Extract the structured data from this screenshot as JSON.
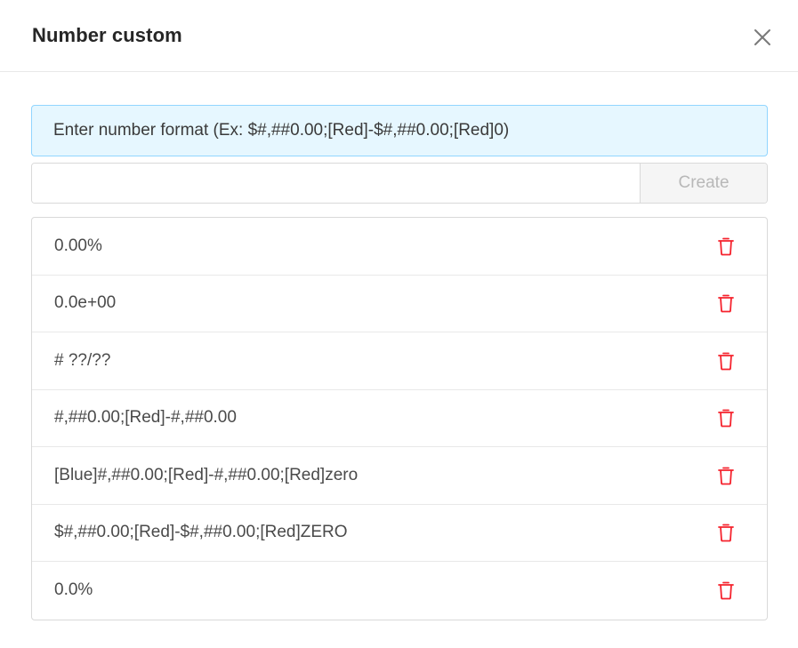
{
  "dialog": {
    "title": "Number custom",
    "close_icon": "close-icon"
  },
  "hint": {
    "text": "Enter number format (Ex: $#,##0.00;[Red]-$#,##0.00;[Red]0)"
  },
  "form": {
    "input_value": "",
    "input_placeholder": "",
    "create_label": "Create"
  },
  "formats": [
    {
      "label": "0.00%"
    },
    {
      "label": "0.0e+00"
    },
    {
      "label": "# ??/??"
    },
    {
      "label": "#,##0.00;[Red]-#,##0.00"
    },
    {
      "label": "[Blue]#,##0.00;[Red]-#,##0.00;[Red]zero"
    },
    {
      "label": "$#,##0.00;[Red]-$#,##0.00;[Red]ZERO"
    },
    {
      "label": "0.0%"
    }
  ],
  "colors": {
    "hint_bg": "#e6f7ff",
    "hint_border": "#91d5ff",
    "delete_icon": "#f5222d",
    "create_disabled_text": "#b8b8b8"
  },
  "icons": {
    "delete": "trash-icon",
    "close": "close-icon"
  }
}
